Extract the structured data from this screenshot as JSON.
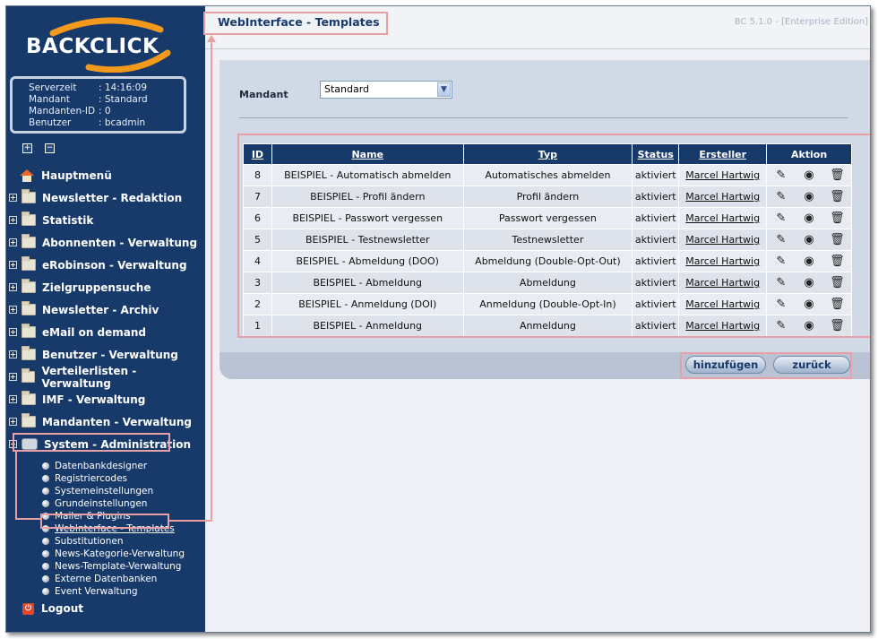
{
  "logo": {
    "text": "BACKCLICK"
  },
  "info": {
    "rows": [
      {
        "key": "Serverzeit",
        "value": ": 14:16:09"
      },
      {
        "key": "Mandant",
        "value": ": Standard"
      },
      {
        "key": "Mandanten-ID",
        "value": ": 0"
      },
      {
        "key": "Benutzer",
        "value": ": bcadmin"
      }
    ]
  },
  "tree": {
    "expand": "+",
    "collapse": "−"
  },
  "menu": {
    "home": "Hauptmenü",
    "items": [
      "Newsletter - Redaktion",
      "Statistik",
      "Abonnenten - Verwaltung",
      "eRobinson - Verwaltung",
      "Zielgruppensuche",
      "Newsletter - Archiv",
      "eMail on demand",
      "Benutzer - Verwaltung",
      "Verteilerlisten - Verwaltung",
      "IMF - Verwaltung",
      "Mandanten - Verwaltung"
    ],
    "system": "System - Administration",
    "sub_items": [
      "Datenbankdesigner",
      "Registriercodes",
      "Systemeinstellungen",
      "Grundeinstellungen",
      "Mailer & Plugins",
      "WebInterface - Templates",
      "Substitutionen",
      "News-Kategorie-Verwaltung",
      "News-Template-Verwaltung",
      "Externe Datenbanken",
      "Event Verwaltung"
    ],
    "logout": "Logout"
  },
  "header": {
    "title": "WebInterface - Templates",
    "version": "BC 5.1.0 - [Enterprise Edition]"
  },
  "filter": {
    "label": "Mandant",
    "selected": "Standard"
  },
  "table": {
    "headers": {
      "id": "ID",
      "name": "Name",
      "typ": "Typ",
      "status": "Status",
      "ersteller": "Ersteller",
      "aktion": "Aktion"
    },
    "rows": [
      {
        "id": "8",
        "name": "BEISPIEL - Automatisch abmelden",
        "typ": "Automatisches abmelden",
        "status": "aktiviert",
        "ersteller": "Marcel Hartwig"
      },
      {
        "id": "7",
        "name": "BEISPIEL - Profil ändern",
        "typ": "Profil ändern",
        "status": "aktiviert",
        "ersteller": "Marcel Hartwig"
      },
      {
        "id": "6",
        "name": "BEISPIEL - Passwort vergessen",
        "typ": "Passwort vergessen",
        "status": "aktiviert",
        "ersteller": "Marcel Hartwig"
      },
      {
        "id": "5",
        "name": "BEISPIEL - Testnewsletter",
        "typ": "Testnewsletter",
        "status": "aktiviert",
        "ersteller": "Marcel Hartwig"
      },
      {
        "id": "4",
        "name": "BEISPIEL - Abmeldung (DOO)",
        "typ": "Abmeldung (Double-Opt-Out)",
        "status": "aktiviert",
        "ersteller": "Marcel Hartwig"
      },
      {
        "id": "3",
        "name": "BEISPIEL - Abmeldung",
        "typ": "Abmeldung",
        "status": "aktiviert",
        "ersteller": "Marcel Hartwig"
      },
      {
        "id": "2",
        "name": "BEISPIEL - Anmeldung (DOI)",
        "typ": "Anmeldung (Double-Opt-In)",
        "status": "aktiviert",
        "ersteller": "Marcel Hartwig"
      },
      {
        "id": "1",
        "name": "BEISPIEL - Anmeldung",
        "typ": "Anmeldung",
        "status": "aktiviert",
        "ersteller": "Marcel Hartwig"
      }
    ],
    "actions": [
      "edit-icon",
      "view-icon",
      "delete-icon"
    ]
  },
  "buttons": {
    "add": "hinzufügen",
    "back": "zurück"
  },
  "colors": {
    "sidebar": "#173a6b",
    "annotation": "#e8a0a4",
    "panel": "#d2d9e6"
  }
}
